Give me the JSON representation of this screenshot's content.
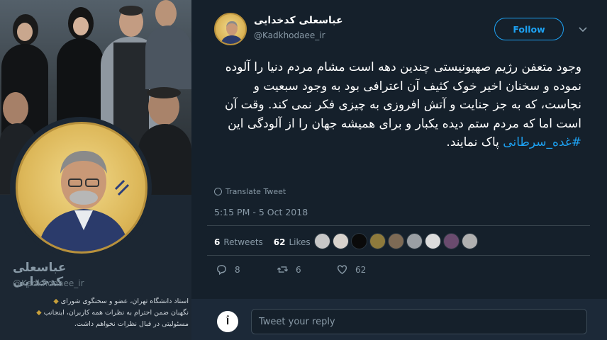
{
  "profile": {
    "display_name": "عباسعلی کدخدایی",
    "handle": "@Kadkhodaee_ir",
    "bio_lines": [
      "استاد دانشگاه تهران، عضو و سخنگوی شورای",
      "نگهبان  ضمن احترام به نظرات همه کاربران، اینجانب",
      "مسئولیتی در قبال نظرات نخواهم داشت."
    ]
  },
  "tweet": {
    "author_name": "عباسعلی کدخدایی",
    "author_handle": "@Kadkhodaee_ir",
    "follow_label": "Follow",
    "text_before_hashtag": "وجود متعفن رژیم صهیونیستی چندین دهه است مشام مردم دنیا را آلوده نموده و سخنان اخیر خوک کثیف آن اعترافی بود به وجود سبعیت و نجاست، که به جز جنایت و آتش افروزی به چیزی فکر نمی کند. وقت آن است اما که مردم ستم دیده یکبار و برای همیشه جهان را از آلودگی این ",
    "hashtag": "#غده_سرطانی",
    "text_after_hashtag": " پاک نمایند.",
    "translate_label": "Translate Tweet",
    "timestamp": "5:15 PM - 5 Oct 2018",
    "retweets_count": "6",
    "retweets_label": "Retweets",
    "likes_count": "62",
    "likes_label": "Likes",
    "reply_count": "8",
    "retweet_action_count": "6",
    "like_action_count": "62",
    "reply_placeholder": "Tweet your reply",
    "reply_avatar_text": "اُ"
  },
  "colors": {
    "accent": "#1da1f2",
    "background": "#15202b",
    "avatar_gold": "#d8b052"
  },
  "likers": [
    "liker-1",
    "liker-2",
    "liker-3",
    "liker-4",
    "liker-5",
    "liker-6",
    "liker-7",
    "liker-8",
    "liker-9"
  ]
}
